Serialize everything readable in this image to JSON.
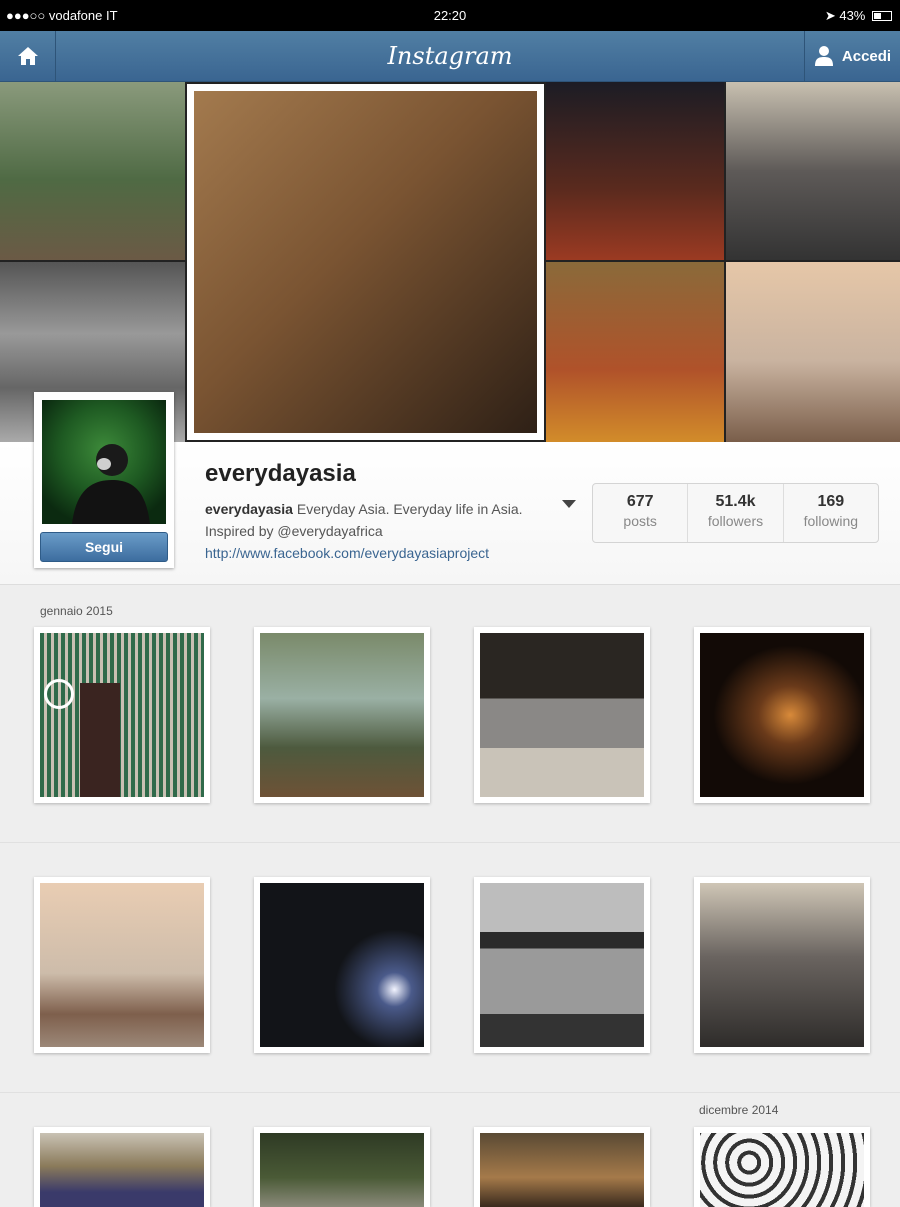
{
  "status_bar": {
    "carrier": "●●●○○ vodafone IT",
    "time": "22:20",
    "battery": "43%"
  },
  "nav": {
    "brand": "Instagram",
    "login_label": "Accedi"
  },
  "profile": {
    "username": "everydayasia",
    "bio_name": "everydayasia",
    "bio_text": " Everyday Asia. Everyday life in Asia. Inspired by @everydayafrica",
    "link": "http://www.facebook.com/everydayasiaproject",
    "follow_label": "Segui"
  },
  "stats": [
    {
      "value": "677",
      "label": "posts"
    },
    {
      "value": "51.4k",
      "label": "followers"
    },
    {
      "value": "169",
      "label": "following"
    }
  ],
  "feed": {
    "sections": [
      {
        "month": "gennaio 2015"
      },
      {
        "month": "dicembre 2014"
      }
    ]
  },
  "colors": {
    "nav_blue": "#3a6591",
    "button_blue": "#4e82b4",
    "link_blue": "#3a6591"
  }
}
